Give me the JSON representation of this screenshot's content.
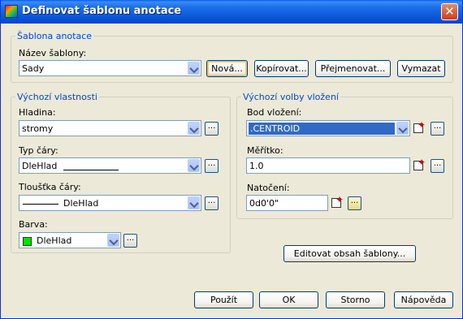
{
  "window": {
    "title": "Definovat šablonu anotace",
    "close_glyph": "✕"
  },
  "template_group": {
    "legend": "Šablona anotace",
    "name_label": "Název šablony:",
    "name_value": "Sady",
    "buttons": {
      "new": "Nová...",
      "copy": "Kopírovat...",
      "rename": "Přejmenovat...",
      "delete": "Vymazat"
    }
  },
  "default_props": {
    "legend": "Výchozí vlastnosti",
    "layer_label": "Hladina:",
    "layer_value": "stromy",
    "linetype_label": "Typ čáry:",
    "linetype_value": "DleHlad",
    "lineweight_label": "Tloušťka čáry:",
    "lineweight_value": "DleHlad",
    "color_label": "Barva:",
    "color_value": "DleHlad",
    "color_swatch": "#00e000",
    "more_glyph": "..."
  },
  "insert_options": {
    "legend": "Výchozí volby vložení",
    "insert_point_label": "Bod vložení:",
    "insert_point_value": ".CENTROID",
    "scale_label": "Měřítko:",
    "scale_value": "1.0",
    "rotation_label": "Natočení:",
    "rotation_value": "0d0'0\"",
    "more_glyph": "..."
  },
  "edit_button": "Editovat obsah šablony...",
  "footer": {
    "apply": "Použít",
    "ok": "OK",
    "cancel": "Storno",
    "help": "Nápověda"
  }
}
